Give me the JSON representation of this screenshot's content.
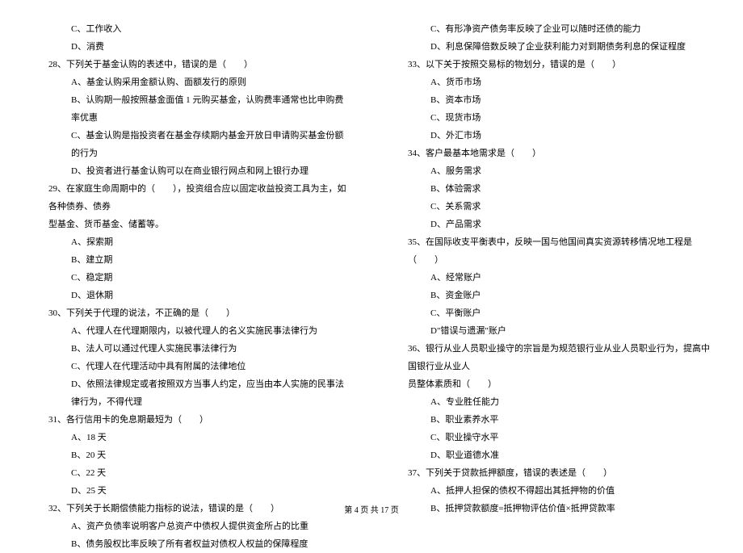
{
  "left_column": {
    "lines": [
      {
        "cls": "option-line",
        "text": "C、工作收入"
      },
      {
        "cls": "option-line",
        "text": "D、消费"
      },
      {
        "cls": "question-line",
        "text": "28、下列关于基金认购的表述中，错误的是（　　）"
      },
      {
        "cls": "option-line",
        "text": "A、基金认购采用金额认购、面额发行的原则"
      },
      {
        "cls": "option-line",
        "text": "B、认购期一般按照基金面值 1 元购买基金，认购费率通常也比申购费率优惠"
      },
      {
        "cls": "option-line",
        "text": "C、基金认购是指投资者在基金存续期内基金开放日申请购买基金份额的行为"
      },
      {
        "cls": "option-line",
        "text": "D、投资者进行基金认购可以在商业银行网点和网上银行办理"
      },
      {
        "cls": "question-line",
        "text": "29、在家庭生命周期中的（　　），投资组合应以固定收益投资工具为主，如各种债券、债券"
      },
      {
        "cls": "sub-line",
        "text": "型基金、货币基金、储蓄等。"
      },
      {
        "cls": "option-line",
        "text": "A、探索期"
      },
      {
        "cls": "option-line",
        "text": "B、建立期"
      },
      {
        "cls": "option-line",
        "text": "C、稳定期"
      },
      {
        "cls": "option-line",
        "text": "D、退休期"
      },
      {
        "cls": "question-line",
        "text": "30、下列关于代理的说法，不正确的是（　　）"
      },
      {
        "cls": "option-line",
        "text": "A、代理人在代理期限内，以被代理人的名义实施民事法律行为"
      },
      {
        "cls": "option-line",
        "text": "B、法人可以通过代理人实施民事法律行为"
      },
      {
        "cls": "option-line",
        "text": "C、代理人在代理活动中具有附属的法律地位"
      },
      {
        "cls": "option-line",
        "text": "D、依照法律规定或者按照双方当事人约定，应当由本人实施的民事法律行为，不得代理"
      },
      {
        "cls": "question-line",
        "text": "31、各行信用卡的免息期最短为（　　）"
      },
      {
        "cls": "option-line",
        "text": "A、18 天"
      },
      {
        "cls": "option-line",
        "text": "B、20 天"
      },
      {
        "cls": "option-line",
        "text": "C、22 天"
      },
      {
        "cls": "option-line",
        "text": "D、25 天"
      },
      {
        "cls": "question-line",
        "text": "32、下列关于长期偿债能力指标的说法，错误的是（　　）"
      },
      {
        "cls": "option-line",
        "text": "A、资产负债率说明客户总资产中债权人提供资金所占的比重"
      },
      {
        "cls": "option-line",
        "text": "B、债务股权比率反映了所有者权益对债权人权益的保障程度"
      }
    ]
  },
  "right_column": {
    "lines": [
      {
        "cls": "option-line",
        "text": "C、有形净资产债务率反映了企业可以随时还债的能力"
      },
      {
        "cls": "option-line",
        "text": "D、利息保障倍数反映了企业获利能力对到期债务利息的保证程度"
      },
      {
        "cls": "question-line",
        "text": "33、以下关于按照交易标的物划分，错误的是（　　）"
      },
      {
        "cls": "option-line",
        "text": "A、货币市场"
      },
      {
        "cls": "option-line",
        "text": "B、资本市场"
      },
      {
        "cls": "option-line",
        "text": "C、现货市场"
      },
      {
        "cls": "option-line",
        "text": "D、外汇市场"
      },
      {
        "cls": "question-line",
        "text": "34、客户最基本地需求是（　　）"
      },
      {
        "cls": "option-line",
        "text": "A、服务需求"
      },
      {
        "cls": "option-line",
        "text": "B、体验需求"
      },
      {
        "cls": "option-line",
        "text": "C、关系需求"
      },
      {
        "cls": "option-line",
        "text": "D、产品需求"
      },
      {
        "cls": "question-line",
        "text": "35、在国际收支平衡表中，反映一国与他国间真实资源转移情况地工程是（　　）"
      },
      {
        "cls": "option-line",
        "text": "A、经常账户"
      },
      {
        "cls": "option-line",
        "text": "B、资金账户"
      },
      {
        "cls": "option-line",
        "text": "C、平衡账户"
      },
      {
        "cls": "option-line",
        "text": "D\"错误与遗漏\"账户"
      },
      {
        "cls": "question-line",
        "text": "36、银行从业人员职业操守的宗旨是为规范银行业从业人员职业行为，提高中国银行业从业人"
      },
      {
        "cls": "sub-line",
        "text": "员整体素质和（　　）"
      },
      {
        "cls": "option-line",
        "text": "A、专业胜任能力"
      },
      {
        "cls": "option-line",
        "text": "B、职业素养水平"
      },
      {
        "cls": "option-line",
        "text": "C、职业操守水平"
      },
      {
        "cls": "option-line",
        "text": "D、职业道德水准"
      },
      {
        "cls": "question-line",
        "text": "37、下列关于贷款抵押额度，错误的表述是（　　）"
      },
      {
        "cls": "option-line",
        "text": "A、抵押人担保的债权不得超出其抵押物的价值"
      },
      {
        "cls": "option-line",
        "text": "B、抵押贷款额度=抵押物评估价值×抵押贷款率"
      }
    ]
  },
  "footer": "第 4 页 共 17 页"
}
